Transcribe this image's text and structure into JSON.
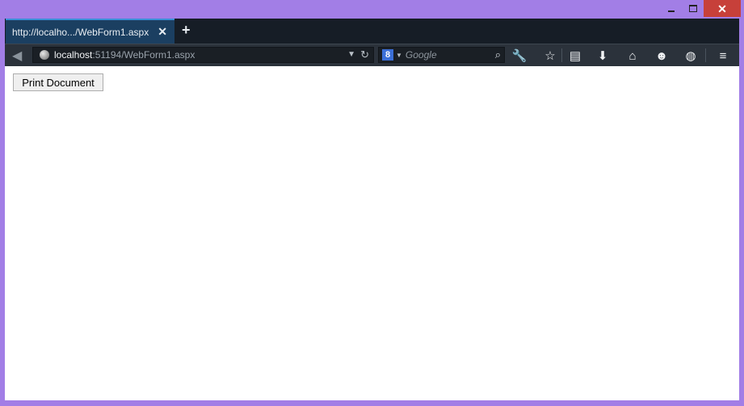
{
  "window": {
    "minimize_icon": "minimize-icon",
    "maximize_icon": "maximize-icon",
    "close_icon": "close-icon",
    "close_glyph": "✕",
    "accent_color": "#a27ee6",
    "close_color": "#c7403a"
  },
  "tabs": [
    {
      "title": "http://localho.../WebForm1.aspx",
      "close_glyph": "✕",
      "active": true
    }
  ],
  "new_tab_glyph": "+",
  "navbar": {
    "back_glyph": "◀",
    "url": {
      "host": "localhost",
      "path": ":51194/WebForm1.aspx"
    },
    "url_dropdown_glyph": "▼",
    "reload_glyph": "↻",
    "search": {
      "engine_glyph": "8",
      "engine_drop_glyph": "▼",
      "placeholder": "Google",
      "go_glyph": "⌕"
    },
    "tools": [
      {
        "name": "wrench-icon",
        "glyph": "🔧"
      },
      {
        "name": "bookmark-star-icon",
        "glyph": "☆"
      },
      {
        "name": "clipboard-icon",
        "glyph": "▤"
      },
      {
        "name": "download-icon",
        "glyph": "⬇"
      },
      {
        "name": "home-icon",
        "glyph": "⌂"
      },
      {
        "name": "smiley-icon",
        "glyph": "☻"
      },
      {
        "name": "addon-globe-icon",
        "glyph": "◍"
      },
      {
        "name": "menu-icon",
        "glyph": "≡"
      }
    ]
  },
  "page": {
    "print_button_label": "Print Document"
  }
}
